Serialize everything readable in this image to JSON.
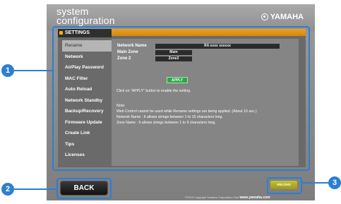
{
  "header": {
    "title_line1": "system",
    "title_line2": "configuration",
    "brand": "YAMAHA"
  },
  "settings": {
    "tab_label": "SETTINGS",
    "menu": [
      "Rename",
      "Network",
      "AirPlay Password",
      "MAC Filter",
      "Auto Reload",
      "Network Standby",
      "Backup/Recovery",
      "Firmware Update",
      "Create Link",
      "Tips",
      "Licenses"
    ]
  },
  "rename": {
    "network_name_label": "Network Name",
    "network_name_value": "RX-xxxx xxxxxx",
    "main_zone_label": "Main Zone",
    "main_zone_value": "Main",
    "zone2_label": "Zone 2",
    "zone2_value": "Zone2",
    "apply_label": "APPLY",
    "instruction": "Click on \"APPLY\" button to enable the setting.",
    "note_title": "Note:",
    "note_1": "Web Control cannot be used while Rename settings are being applied. (About 10 sec.)",
    "note_2": "Network Name : It allows strings between 1 to 15 characters long.",
    "note_3": "Zone Name : It allows strings between 1 to 9 characters long."
  },
  "footer": {
    "back_label": "BACK",
    "reload_label": "RELOAD",
    "copyright": "©2015 Copyright Yamaha Corporation Visit",
    "website": "www.yamaha.com"
  },
  "callouts": [
    "1",
    "2",
    "3"
  ],
  "colors": {
    "accent_orange": "#e89818",
    "callout_blue": "#2c7fd1",
    "apply_green": "#2ea64a",
    "reload_yellow": "#b3ac27"
  }
}
